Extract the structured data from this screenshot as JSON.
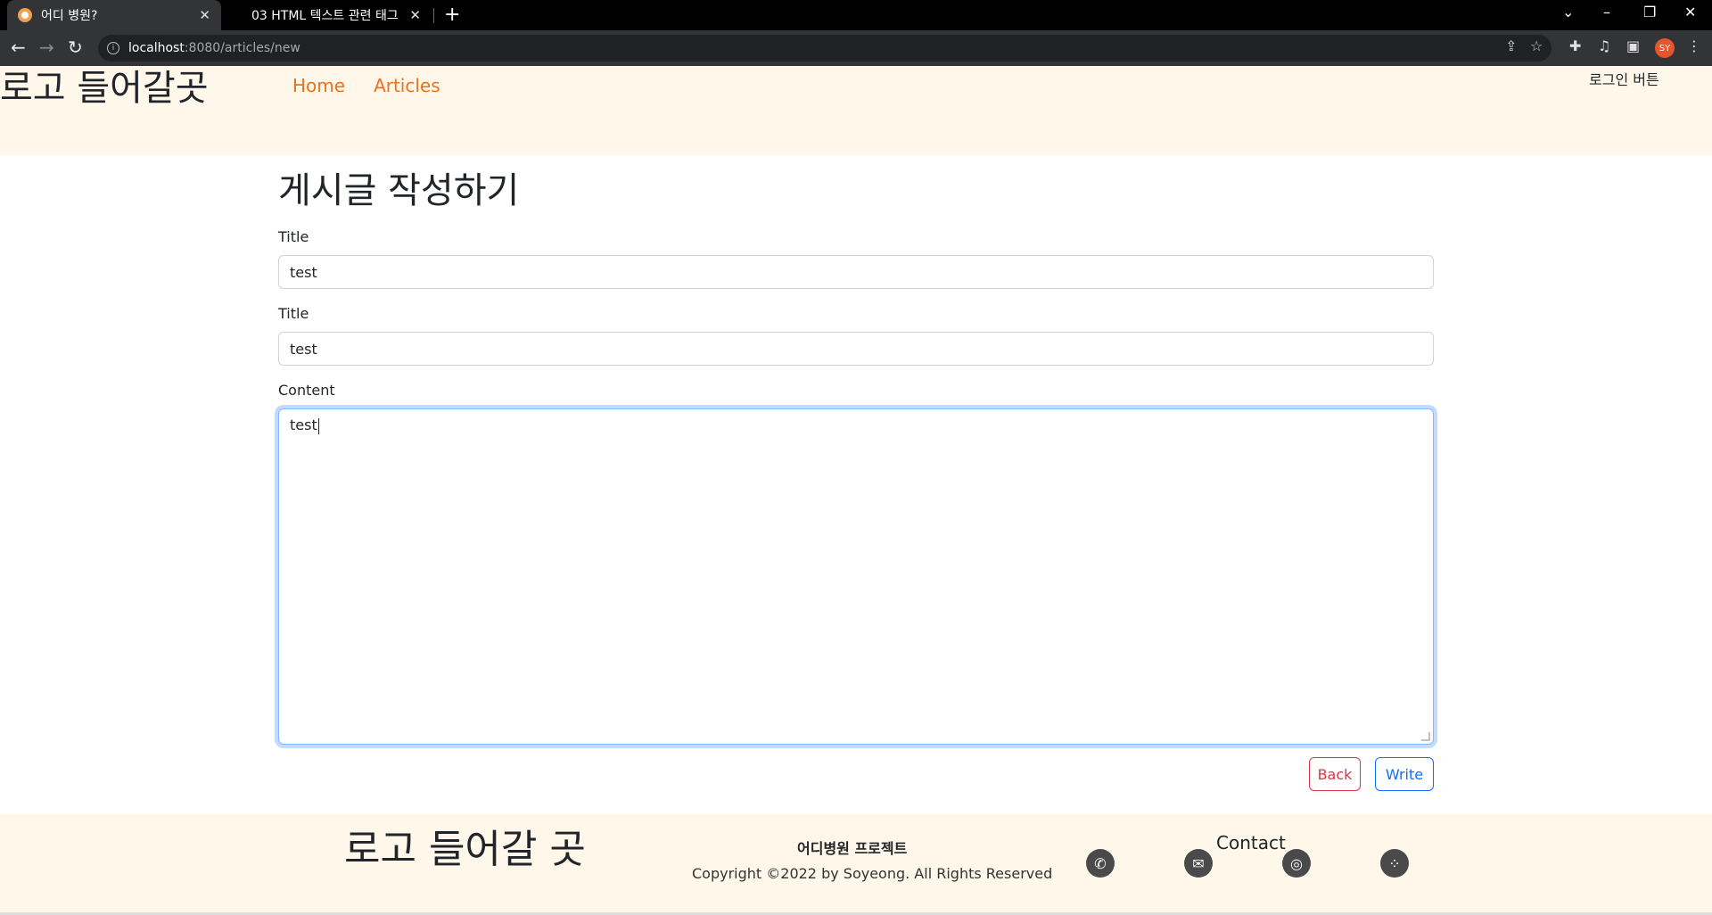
{
  "browser": {
    "tabs": [
      {
        "title": "어디 병원?",
        "active": true
      },
      {
        "title": "03 HTML 텍스트 관련 태그",
        "active": false
      }
    ],
    "url_host": "localhost",
    "url_path": ":8080/articles/new",
    "profile_initials": "SY"
  },
  "header": {
    "logo": "로고 들어갈곳",
    "nav": [
      "Home",
      "Articles"
    ],
    "login": "로그인 버튼"
  },
  "form": {
    "heading": "게시글 작성하기",
    "fields": [
      {
        "label": "Title",
        "value": "test"
      },
      {
        "label": "Title",
        "value": "test"
      }
    ],
    "content_label": "Content",
    "content_value": "test",
    "back_label": "Back",
    "write_label": "Write"
  },
  "footer": {
    "logo": "로고 들어갈 곳",
    "project": "어디병원 프로젝트",
    "copyright": "Copyright ©2022 by Soyeong. All Rights Reserved",
    "contact_title": "Contact",
    "socials": [
      "whatsapp-icon",
      "mail-icon",
      "instagram-icon",
      "more-icon"
    ]
  },
  "colors": {
    "header_bg": "#fff7ea",
    "nav_link": "#e8731f",
    "back_button": "#dc3545",
    "write_button": "#0d6efd"
  }
}
